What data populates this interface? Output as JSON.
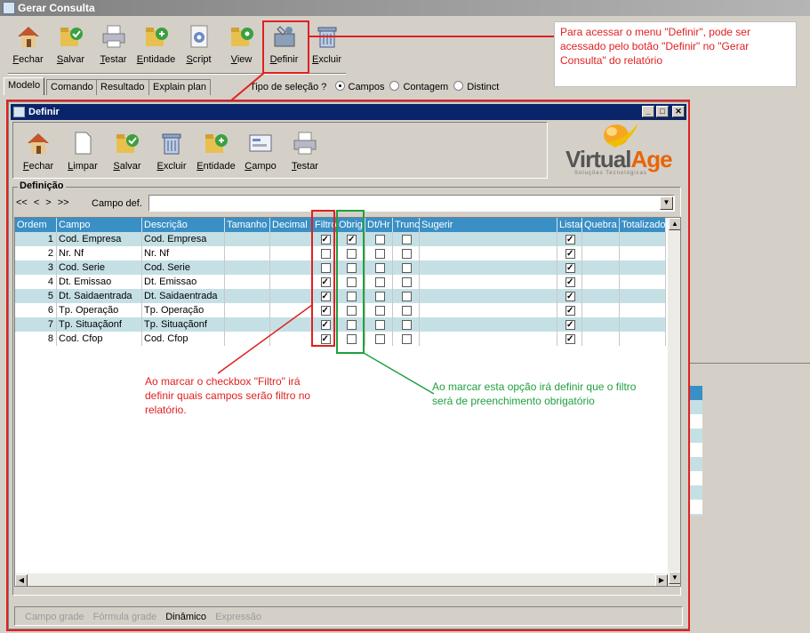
{
  "window": {
    "title": "Gerar Consulta"
  },
  "toolbar": [
    {
      "label": "Fechar",
      "u": "F",
      "rest": "echar",
      "icon": "home-icon"
    },
    {
      "label": "Salvar",
      "u": "S",
      "rest": "alvar",
      "icon": "save-folder-icon"
    },
    {
      "label": "Testar",
      "u": "T",
      "rest": "estar",
      "icon": "printer-icon"
    },
    {
      "label": "Entidade",
      "u": "E",
      "rest": "ntidade",
      "icon": "entity-folder-icon"
    },
    {
      "label": "Script",
      "u": "S",
      "rest": "cript",
      "icon": "script-gear-icon"
    },
    {
      "label": "View",
      "u": "V",
      "rest": "iew",
      "icon": "view-folder-icon"
    },
    {
      "label": "Definir",
      "u": "D",
      "rest": "efinir",
      "icon": "wrench-icon"
    },
    {
      "label": "Excluir",
      "u": "E",
      "rest": "xcluir",
      "icon": "trash-icon"
    }
  ],
  "tabs": [
    "Modelo",
    "Comando",
    "Resultado",
    "Explain plan"
  ],
  "selection": {
    "label": "Tipo de seleção ?",
    "options": [
      "Campos",
      "Contagem",
      "Distinct"
    ],
    "selected": "Campos"
  },
  "callouts": {
    "definir_note": "Para acessar o menu \"Definir\", pode ser acessado pelo botão \"Definir\" no \"Gerar Consulta\" do relatório",
    "filtro_note": "Ao marcar o checkbox \"Filtro\" irá definir quais campos serão filtro no relatório.",
    "obrig_note": "Ao marcar esta opção irá definir que o filtro será de preenchimento obrigatório"
  },
  "dialog": {
    "title": "Definir",
    "toolbar": [
      {
        "label": "Fechar",
        "u": "F",
        "rest": "echar",
        "icon": "home-icon"
      },
      {
        "label": "Limpar",
        "u": "L",
        "rest": "impar",
        "icon": "blank-page-icon"
      },
      {
        "label": "Salvar",
        "u": "S",
        "rest": "alvar",
        "icon": "save-folder-icon"
      },
      {
        "label": "Excluir",
        "u": "E",
        "rest": "xcluir",
        "icon": "trash-icon"
      },
      {
        "label": "Entidade",
        "u": "E",
        "rest": "ntidade",
        "icon": "entity-folder-icon"
      },
      {
        "label": "Campo",
        "u": "C",
        "rest": "ampo",
        "icon": "field-form-icon"
      },
      {
        "label": "Testar",
        "u": "T",
        "rest": "estar",
        "icon": "printer-icon"
      }
    ],
    "logo": {
      "text1": "Virtual",
      "text2": "Age",
      "tagline": "Soluções Tecnológicas"
    },
    "section_label": "Definição",
    "nav": [
      "<<",
      "<",
      ">",
      ">>"
    ],
    "campo_def_label": "Campo def.",
    "columns": [
      "Ordem",
      "Campo",
      "Descrição",
      "Tamanho",
      "Decimal",
      "Filtro",
      "Obrig.",
      "Dt/Hr",
      "Trunc",
      "Sugerir",
      "Listar",
      "Quebra",
      "Totalizado"
    ],
    "rows": [
      {
        "ordem": "1",
        "campo": "Cod. Empresa",
        "descricao": "Cod. Empresa",
        "filtro": true,
        "obrig": true,
        "dthr": false,
        "trunc": false,
        "listar": true
      },
      {
        "ordem": "2",
        "campo": "Nr. Nf",
        "descricao": "Nr. Nf",
        "filtro": false,
        "obrig": false,
        "dthr": false,
        "trunc": false,
        "listar": true
      },
      {
        "ordem": "3",
        "campo": "Cod. Serie",
        "descricao": "Cod. Serie",
        "filtro": false,
        "obrig": false,
        "dthr": false,
        "trunc": false,
        "listar": true
      },
      {
        "ordem": "4",
        "campo": "Dt. Emissao",
        "descricao": "Dt. Emissao",
        "filtro": true,
        "obrig": false,
        "dthr": false,
        "trunc": false,
        "listar": true
      },
      {
        "ordem": "5",
        "campo": "Dt. Saidaentrada",
        "descricao": "Dt. Saidaentrada",
        "filtro": true,
        "obrig": false,
        "dthr": false,
        "trunc": false,
        "listar": true
      },
      {
        "ordem": "6",
        "campo": "Tp. Operação",
        "descricao": "Tp. Operação",
        "filtro": true,
        "obrig": false,
        "dthr": false,
        "trunc": false,
        "listar": true
      },
      {
        "ordem": "7",
        "campo": "Tp. Situaçãonf",
        "descricao": "Tp. Situaçãonf",
        "filtro": true,
        "obrig": false,
        "dthr": false,
        "trunc": false,
        "listar": true
      },
      {
        "ordem": "8",
        "campo": "Cod. Cfop",
        "descricao": "Cod. Cfop",
        "filtro": true,
        "obrig": false,
        "dthr": false,
        "trunc": false,
        "listar": true
      }
    ],
    "bottom_tabs": [
      "Campo grade",
      "Fórmula grade",
      "Dinâmico",
      "Expressão"
    ],
    "bottom_active": "Dinâmico"
  },
  "colors": {
    "header": "#3a8fc5",
    "row_alt": "#c5e0e5",
    "callout_red": "#e02020",
    "callout_green": "#20a040",
    "title_active": "#0a246a"
  }
}
